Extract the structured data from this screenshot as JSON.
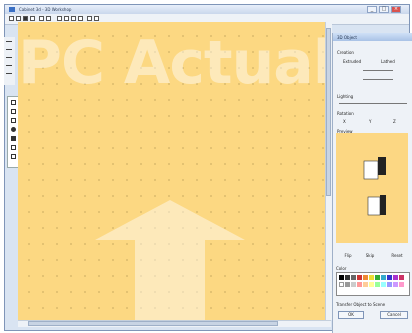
{
  "window": {
    "title": "Cabinet 3d - 3D Workshop"
  },
  "canvas": {
    "watermark_text": "PC Actual"
  },
  "panel": {
    "title": "3D Object",
    "creation_label": "Creation",
    "extruded_label": "Extruded",
    "lathe_label": "Lathed",
    "lighting_label": "Lighting",
    "rotation_label": "Rotation",
    "rotation_x": "X",
    "rotation_y": "Y",
    "rotation_z": "Z",
    "preview_label": "Preview",
    "flip_label": "Flip",
    "skip_label": "Skip",
    "reset_label": "Reset",
    "color_label": "Color",
    "transfer_label": "Transfer Object to Scene",
    "ok_label": "OK",
    "cancel_label": "Cancel"
  },
  "colors": {
    "canvas_bg": "#fcd882",
    "panel_bg": "#eef2f7",
    "titlebar": "#c9d7ec"
  }
}
